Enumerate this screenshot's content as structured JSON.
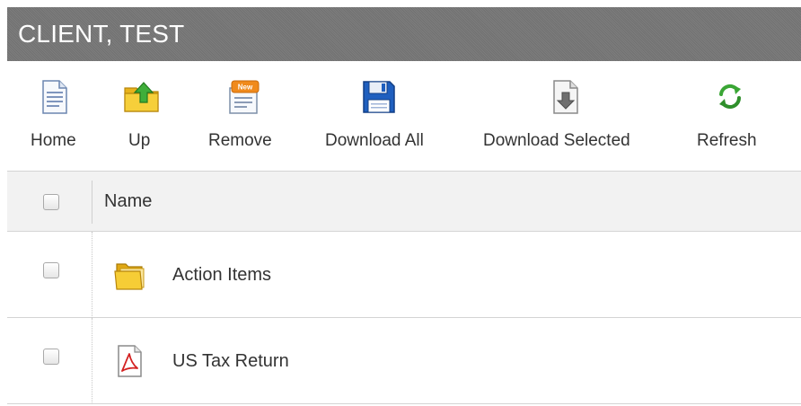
{
  "header": {
    "title": "CLIENT, TEST"
  },
  "toolbar": {
    "home_label": "Home",
    "up_label": "Up",
    "remove_label": "Remove",
    "remove_badge": "New",
    "download_all_label": "Download All",
    "download_selected_label": "Download Selected",
    "refresh_label": "Refresh"
  },
  "grid": {
    "columns": {
      "name": "Name"
    },
    "rows": [
      {
        "name": "Action Items",
        "icon": "folder-icon",
        "checked": false
      },
      {
        "name": "US Tax Return",
        "icon": "pdf-file-icon",
        "checked": false
      }
    ]
  },
  "colors": {
    "header_bg": "#767676",
    "header_text": "#ffffff",
    "grid_head_bg": "#f2f2f2",
    "border": "#d4d4d4",
    "floppy_blue": "#1f5fbf",
    "refresh_green": "#3aa635",
    "folder_yellow": "#f5c518",
    "pdf_red": "#d32020"
  }
}
